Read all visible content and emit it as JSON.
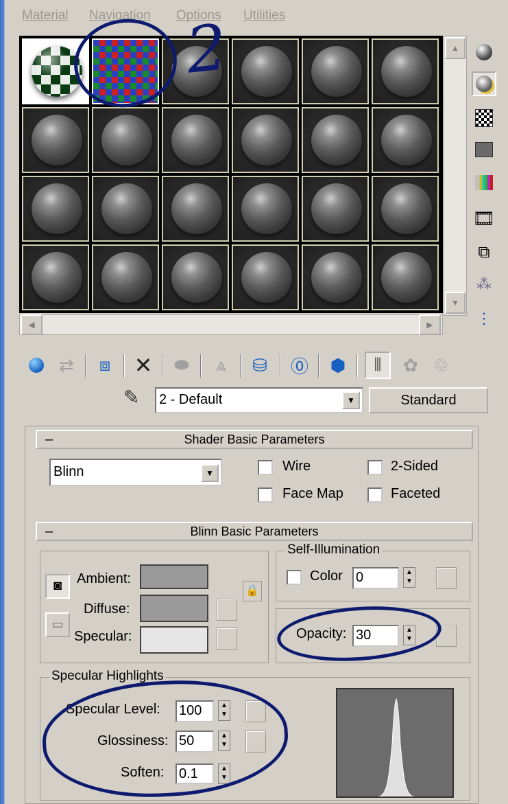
{
  "menu": {
    "material": "Material",
    "navigation": "Navigation",
    "options": "Options",
    "utilities": "Utilities"
  },
  "annotation": {
    "number": "2"
  },
  "material_select": {
    "value": "2 - Default",
    "type_button": "Standard"
  },
  "shader_rollout": {
    "title": "Shader Basic Parameters",
    "shader": "Blinn",
    "wire": "Wire",
    "two_sided": "2-Sided",
    "face_map": "Face Map",
    "faceted": "Faceted"
  },
  "blinn_rollout": {
    "title": "Blinn Basic Parameters",
    "ambient": "Ambient:",
    "diffuse": "Diffuse:",
    "specular": "Specular:",
    "self_illum_title": "Self-Illumination",
    "color_label": "Color",
    "color_value": "0",
    "opacity_label": "Opacity:",
    "opacity_value": "30",
    "colors": {
      "ambient": "#9a9a9a",
      "diffuse": "#9a9a9a",
      "specular": "#e6e6e6"
    }
  },
  "specular_highlights": {
    "title": "Specular Highlights",
    "level_label": "Specular Level:",
    "level_value": "100",
    "gloss_label": "Glossiness:",
    "gloss_value": "50",
    "soften_label": "Soften:",
    "soften_value": "0.1"
  },
  "icons": {
    "right_toolbar": [
      "sample-type-sphere-icon",
      "backlight-icon",
      "background-checker-icon",
      "sample-uv-tiling-icon",
      "video-color-check-icon",
      "make-preview-icon",
      "options-icon",
      "select-by-material-icon",
      "material-map-navigator-icon"
    ],
    "bottom_toolbar": [
      "get-material-icon",
      "put-material-to-scene-icon",
      "assign-material-icon",
      "reset-map-icon",
      "make-material-copy-icon",
      "make-unique-icon",
      "put-to-library-icon",
      "material-effects-channel-icon",
      "show-map-in-viewport-icon",
      "show-end-result-icon",
      "go-to-parent-icon",
      "go-forward-to-sibling-icon"
    ]
  }
}
